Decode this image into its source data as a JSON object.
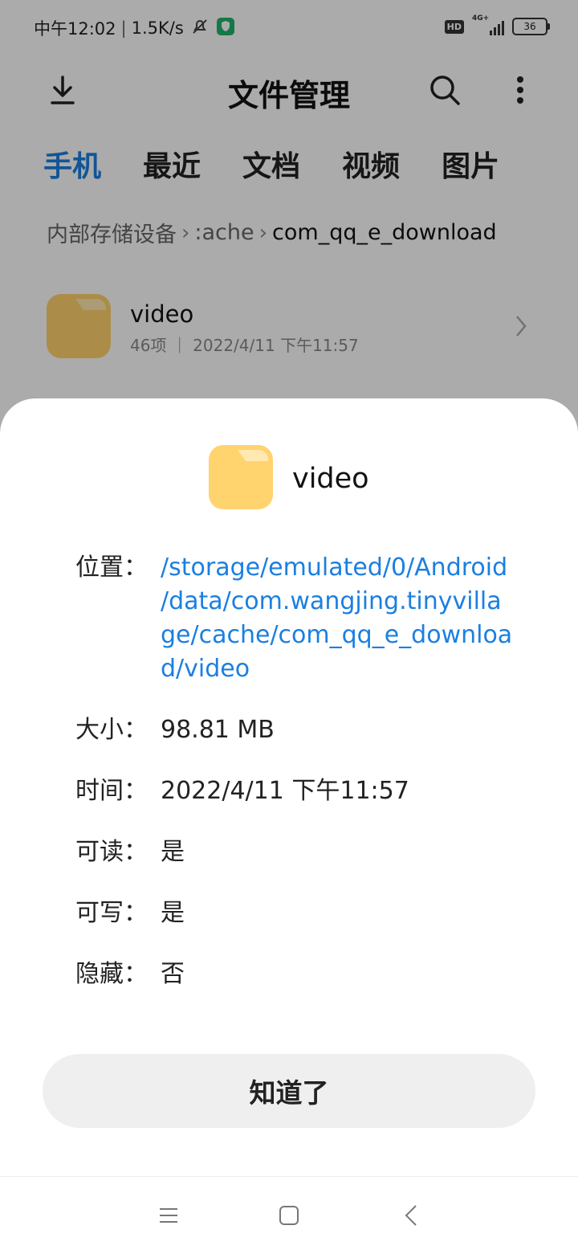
{
  "status_bar": {
    "time": "中午12:02",
    "speed": "1.5K/s",
    "hd_badge": "HD",
    "network": "4G+",
    "battery": "36"
  },
  "toolbar": {
    "title": "文件管理",
    "download_icon": "download-icon",
    "search_icon": "search-icon",
    "more_icon": "more-vertical-icon"
  },
  "tabs": [
    {
      "label": "手机",
      "active": true
    },
    {
      "label": "最近",
      "active": false
    },
    {
      "label": "文档",
      "active": false
    },
    {
      "label": "视频",
      "active": false
    },
    {
      "label": "图片",
      "active": false
    }
  ],
  "breadcrumb": {
    "root": "内部存储设备",
    "middle": ":ache",
    "current": "com_qq_e_download"
  },
  "folder_row": {
    "name": "video",
    "meta": "46项 ｜ 2022/4/11 下午11:57"
  },
  "sheet": {
    "name": "video",
    "location_label": "位置：",
    "location_value": "/storage/emulated/0/Android/data/com.wangjing.tinyvillage/cache/com_qq_e_download/video",
    "size_label": "大小：",
    "size_value": "98.81 MB",
    "time_label": "时间：",
    "time_value": "2022/4/11 下午11:57",
    "readable_label": "可读：",
    "readable_value": "是",
    "writable_label": "可写：",
    "writable_value": "是",
    "hidden_label": "隐藏：",
    "hidden_value": "否",
    "ok_button": "知道了"
  },
  "colors": {
    "accent": "#1b7fe0",
    "folder": "#ffd36e"
  }
}
